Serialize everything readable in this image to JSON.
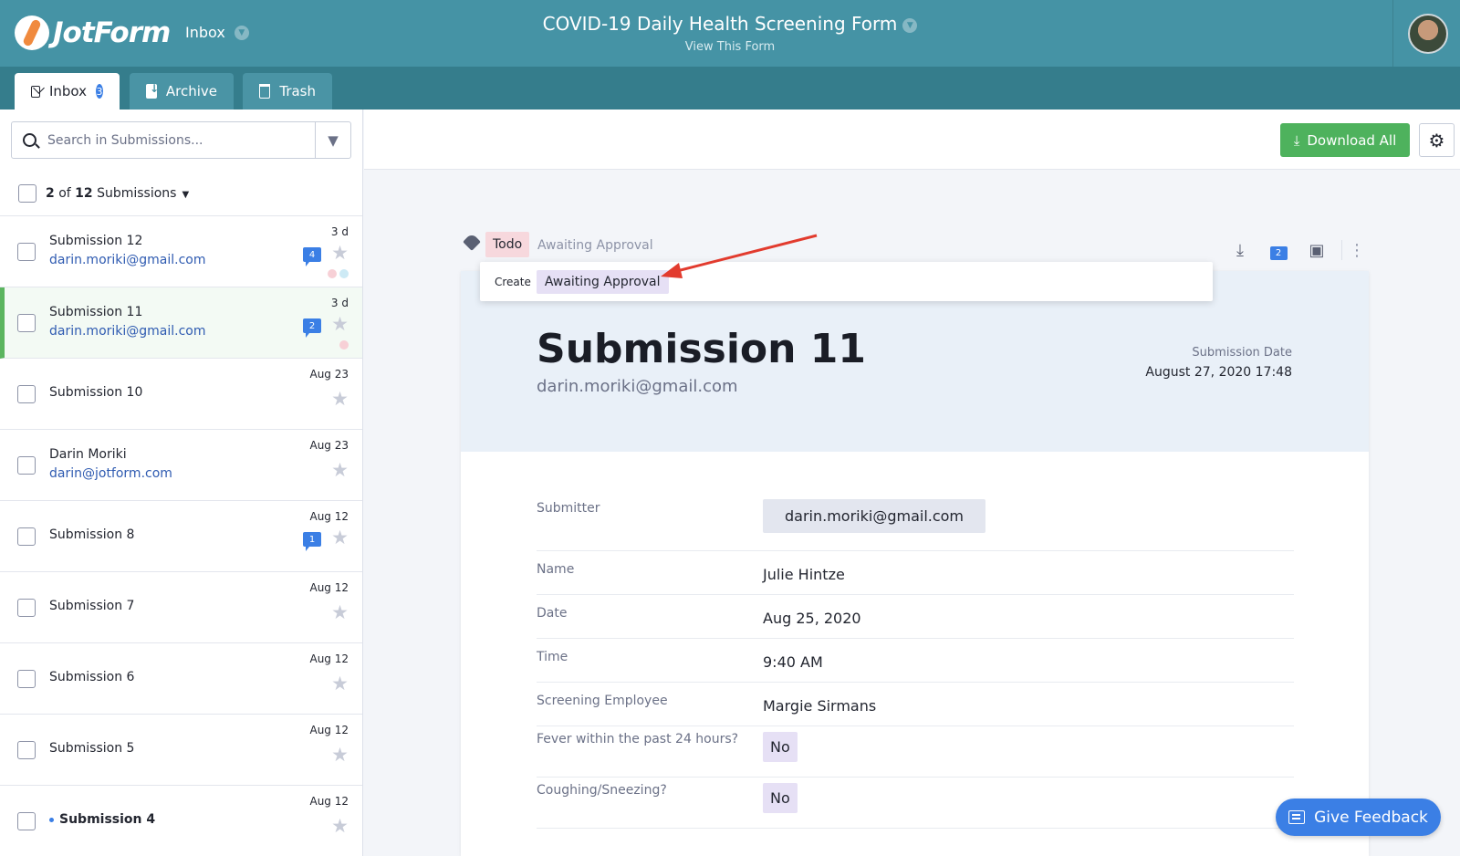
{
  "header": {
    "logo_text": "JotForm",
    "inbox_label": "Inbox",
    "form_title": "COVID-19 Daily Health Screening Form",
    "view_form": "View This Form"
  },
  "tabs": [
    {
      "label": "Inbox",
      "badge": "3"
    },
    {
      "label": "Archive"
    },
    {
      "label": "Trash"
    }
  ],
  "search": {
    "placeholder": "Search in Submissions..."
  },
  "list_summary": {
    "selected": "2",
    "of_text": "of",
    "total": "12",
    "suffix": "Submissions"
  },
  "submissions": [
    {
      "title": "Submission 12",
      "email": "darin.moriki@gmail.com",
      "date": "3 d",
      "comments": "4",
      "dots": [
        "#f7d0d6",
        "#cdeaf5"
      ]
    },
    {
      "title": "Submission 11",
      "email": "darin.moriki@gmail.com",
      "date": "3 d",
      "comments": "2",
      "dots": [
        "#f7d0d6"
      ],
      "selected": true
    },
    {
      "title": "Submission 10",
      "email": "",
      "date": "Aug 23"
    },
    {
      "title": "Darin Moriki",
      "email": "darin@jotform.com",
      "date": "Aug 23"
    },
    {
      "title": "Submission 8",
      "email": "",
      "date": "Aug 12",
      "comments": "1"
    },
    {
      "title": "Submission 7",
      "email": "",
      "date": "Aug 12"
    },
    {
      "title": "Submission 6",
      "email": "",
      "date": "Aug 12"
    },
    {
      "title": "Submission 5",
      "email": "",
      "date": "Aug 12"
    },
    {
      "title": "Submission 4",
      "email": "",
      "date": "Aug 12",
      "unread": true
    }
  ],
  "toolbar": {
    "download_all": "Download All"
  },
  "tags": {
    "todo": "Todo",
    "input_placeholder": "Awaiting Approval",
    "comment_count": "2"
  },
  "create_dropdown": {
    "create_label": "Create",
    "option": "Awaiting Approval"
  },
  "document": {
    "title": "Submission 11",
    "email": "darin.moriki@gmail.com",
    "date_label": "Submission Date",
    "date_value": "August 27, 2020 17:48",
    "fields": [
      {
        "label": "Submitter",
        "value": "darin.moriki@gmail.com"
      },
      {
        "label": "Name",
        "value": "Julie Hintze"
      },
      {
        "label": "Date",
        "value": "Aug 25, 2020"
      },
      {
        "label": "Time",
        "value": "9:40 AM"
      },
      {
        "label": "Screening Employee",
        "value": "Margie Sirmans"
      },
      {
        "label": "Fever within the past 24 hours?",
        "value": "No"
      },
      {
        "label": "Coughing/Sneezing?",
        "value": "No"
      }
    ]
  },
  "feedback": {
    "label": "Give Feedback"
  },
  "colors": {
    "header": "#4593a5",
    "tabbar": "#357d8c",
    "accent_green": "#4eb25d",
    "accent_blue": "#3b7fe5"
  }
}
